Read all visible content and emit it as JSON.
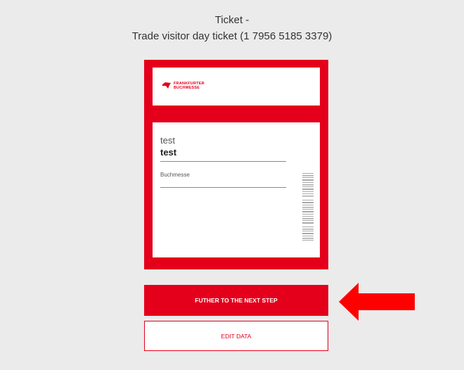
{
  "header": {
    "line1": "Ticket -",
    "line2": "Trade visitor day ticket (1 7956 5185 3379)"
  },
  "ticket": {
    "logo": {
      "line1": "FRANKFURTER",
      "line2": "BUCHMESSE"
    },
    "first_name": "test",
    "last_name": "test",
    "company": "Buchmesse"
  },
  "buttons": {
    "next_label": "FUTHER TO THE NEXT STEP",
    "edit_label": "EDIT DATA"
  },
  "colors": {
    "brand": "#e4001b",
    "background": "#ebebeb",
    "arrow": "#ff0000"
  },
  "icons": {
    "logo": "frankfurter-buchmesse-logo-icon",
    "barcode": "barcode-icon",
    "arrow": "left-arrow-icon"
  }
}
